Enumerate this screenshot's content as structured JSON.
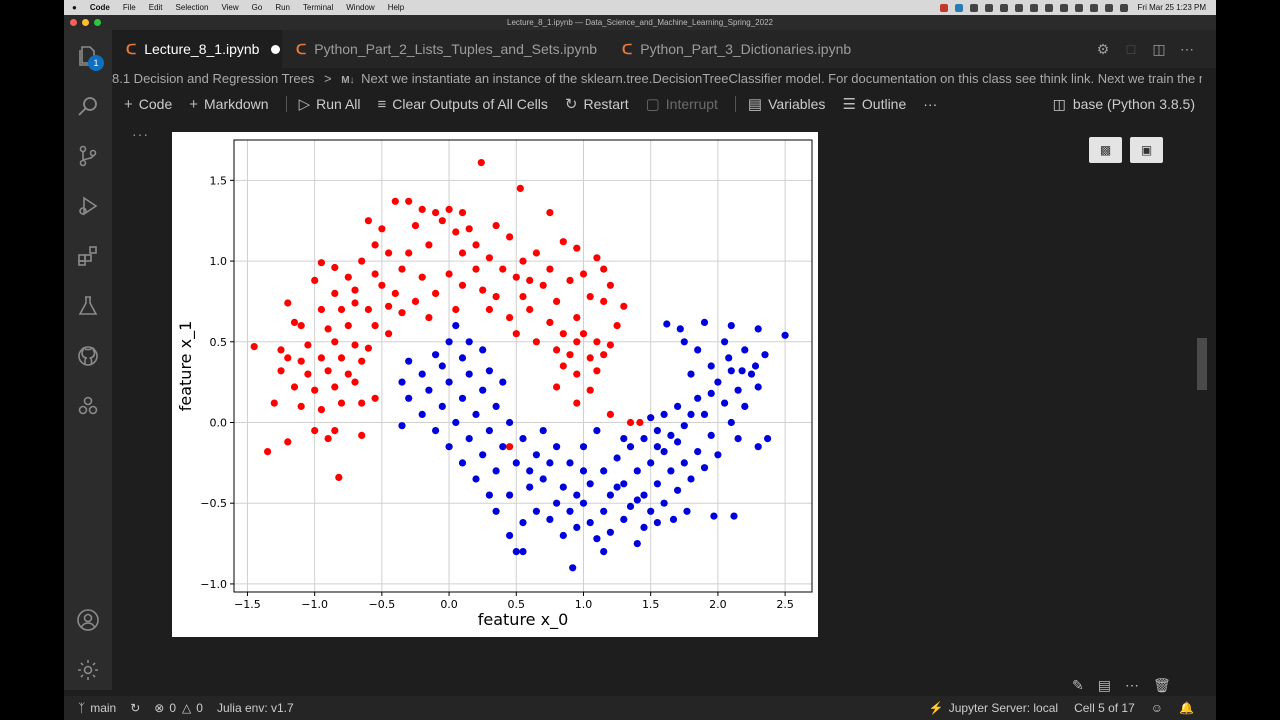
{
  "os_menubar": {
    "apple": "",
    "app_name": "Code",
    "menus": [
      "File",
      "Edit",
      "Selection",
      "View",
      "Go",
      "Run",
      "Terminal",
      "Window",
      "Help"
    ],
    "clock": "Fri Mar 25  1:23 PM"
  },
  "window": {
    "title": "Lecture_8_1.ipynb — Data_Science_and_Machine_Learning_Spring_2022"
  },
  "activity_bar": {
    "explorer_badge": "1",
    "items": [
      "explorer-icon",
      "search-icon",
      "source-control-icon",
      "run-debug-icon",
      "extensions-icon",
      "testing-icon",
      "github-icon",
      "remote-icon"
    ],
    "bottom": [
      "account-icon",
      "settings-gear-icon"
    ]
  },
  "tabs": [
    {
      "label": "Lecture_8_1.ipynb",
      "active": true,
      "dirty": true
    },
    {
      "label": "Python_Part_2_Lists_Tuples_and_Sets.ipynb",
      "active": false
    },
    {
      "label": "Python_Part_3_Dictionaries.ipynb",
      "active": false
    }
  ],
  "breadcrumb": {
    "section": "8.1 Decision and Regression Trees",
    "separator": ">",
    "md_badge": "M↓",
    "cell": "Next we instantiate an instance of the sklearn.tree.DecisionTreeClassifier model. For documentation on this class see think link. Next we train the m..."
  },
  "toolbar": {
    "code": "Code",
    "markdown": "Markdown",
    "run_all": "Run All",
    "clear_outputs": "Clear Outputs of All Cells",
    "restart": "Restart",
    "interrupt": "Interrupt",
    "variables": "Variables",
    "outline": "Outline",
    "more": "···",
    "kernel": "base (Python 3.8.5)"
  },
  "cell_more": "···",
  "status_bar": {
    "branch": "main",
    "errors": "0",
    "warnings": "0",
    "julia": "Julia env: v1.7",
    "jupyter": "Jupyter Server: local",
    "cell_position": "Cell 5 of 17"
  },
  "colors": {
    "class_0": "#ff0000",
    "class_1": "#0000dd",
    "editor_bg": "#1e1e1e",
    "accent": "#0e70c0"
  },
  "chart_data": {
    "type": "scatter",
    "title": "",
    "xlabel": "feature x_0",
    "ylabel": "feature x_1",
    "xlim": [
      -1.6,
      2.7
    ],
    "ylim": [
      -1.05,
      1.75
    ],
    "xticks": [
      -1.5,
      -1.0,
      -0.5,
      0.0,
      0.5,
      1.0,
      1.5,
      2.0,
      2.5
    ],
    "yticks": [
      -1.0,
      -0.5,
      0.0,
      0.5,
      1.0,
      1.5
    ],
    "xtick_labels": [
      "−1.5",
      "−1.0",
      "−0.5",
      "0.0",
      "0.5",
      "1.0",
      "1.5",
      "2.0",
      "2.5"
    ],
    "ytick_labels": [
      "−1.0",
      "−0.5",
      "0.0",
      "0.5",
      "1.0",
      "1.5"
    ],
    "grid": true,
    "series": [
      {
        "color": "#ff0000",
        "points": [
          [
            0.24,
            1.61
          ],
          [
            0.53,
            1.45
          ],
          [
            -0.4,
            1.37
          ],
          [
            -0.3,
            1.37
          ],
          [
            -0.2,
            1.32
          ],
          [
            -0.1,
            1.3
          ],
          [
            0.0,
            1.32
          ],
          [
            0.1,
            1.3
          ],
          [
            -0.6,
            1.25
          ],
          [
            -0.5,
            1.2
          ],
          [
            -0.25,
            1.22
          ],
          [
            -0.05,
            1.25
          ],
          [
            0.05,
            1.18
          ],
          [
            0.15,
            1.2
          ],
          [
            0.35,
            1.22
          ],
          [
            0.45,
            1.15
          ],
          [
            0.75,
            1.3
          ],
          [
            0.95,
            1.08
          ],
          [
            0.85,
            1.12
          ],
          [
            1.1,
            1.02
          ],
          [
            -0.95,
            0.99
          ],
          [
            -0.85,
            0.96
          ],
          [
            -0.65,
            1.0
          ],
          [
            -0.45,
            1.05
          ],
          [
            -0.15,
            1.1
          ],
          [
            0.1,
            1.05
          ],
          [
            0.2,
            1.1
          ],
          [
            0.3,
            1.02
          ],
          [
            0.55,
            1.0
          ],
          [
            0.65,
            1.05
          ],
          [
            0.75,
            0.95
          ],
          [
            1.0,
            0.92
          ],
          [
            1.15,
            0.95
          ],
          [
            1.2,
            0.85
          ],
          [
            -1.0,
            0.88
          ],
          [
            -0.75,
            0.9
          ],
          [
            -0.55,
            0.92
          ],
          [
            -0.35,
            0.95
          ],
          [
            -0.2,
            0.9
          ],
          [
            0.0,
            0.92
          ],
          [
            0.4,
            0.95
          ],
          [
            0.5,
            0.9
          ],
          [
            0.7,
            0.85
          ],
          [
            0.9,
            0.88
          ],
          [
            1.05,
            0.78
          ],
          [
            -0.85,
            0.8
          ],
          [
            -0.7,
            0.82
          ],
          [
            -0.5,
            0.85
          ],
          [
            -0.4,
            0.8
          ],
          [
            -0.25,
            0.75
          ],
          [
            -0.1,
            0.8
          ],
          [
            0.1,
            0.85
          ],
          [
            0.25,
            0.82
          ],
          [
            0.35,
            0.78
          ],
          [
            0.55,
            0.78
          ],
          [
            0.8,
            0.75
          ],
          [
            1.15,
            0.75
          ],
          [
            1.3,
            0.72
          ],
          [
            -1.2,
            0.74
          ],
          [
            -0.95,
            0.7
          ],
          [
            -0.8,
            0.7
          ],
          [
            -0.6,
            0.7
          ],
          [
            -0.45,
            0.72
          ],
          [
            -0.35,
            0.68
          ],
          [
            -0.15,
            0.65
          ],
          [
            0.05,
            0.7
          ],
          [
            0.3,
            0.7
          ],
          [
            0.45,
            0.65
          ],
          [
            0.6,
            0.7
          ],
          [
            0.75,
            0.62
          ],
          [
            0.95,
            0.65
          ],
          [
            1.0,
            0.55
          ],
          [
            1.25,
            0.6
          ],
          [
            -1.15,
            0.62
          ],
          [
            -1.1,
            0.6
          ],
          [
            -0.9,
            0.58
          ],
          [
            -0.75,
            0.6
          ],
          [
            -0.55,
            0.6
          ],
          [
            -0.45,
            0.55
          ],
          [
            0.5,
            0.55
          ],
          [
            0.65,
            0.5
          ],
          [
            0.85,
            0.55
          ],
          [
            0.95,
            0.5
          ],
          [
            1.1,
            0.5
          ],
          [
            1.2,
            0.48
          ],
          [
            -1.45,
            0.47
          ],
          [
            -1.25,
            0.45
          ],
          [
            -1.05,
            0.48
          ],
          [
            -0.85,
            0.5
          ],
          [
            -0.7,
            0.48
          ],
          [
            -0.6,
            0.46
          ],
          [
            0.8,
            0.45
          ],
          [
            0.9,
            0.42
          ],
          [
            1.05,
            0.4
          ],
          [
            1.15,
            0.42
          ],
          [
            -1.2,
            0.4
          ],
          [
            -1.1,
            0.38
          ],
          [
            -0.95,
            0.4
          ],
          [
            -0.8,
            0.4
          ],
          [
            -0.65,
            0.38
          ],
          [
            -1.25,
            0.32
          ],
          [
            -1.05,
            0.3
          ],
          [
            -0.9,
            0.32
          ],
          [
            -0.75,
            0.3
          ],
          [
            0.85,
            0.35
          ],
          [
            0.95,
            0.3
          ],
          [
            1.1,
            0.32
          ],
          [
            -1.15,
            0.22
          ],
          [
            -1.0,
            0.2
          ],
          [
            -0.85,
            0.22
          ],
          [
            -0.7,
            0.25
          ],
          [
            0.8,
            0.22
          ],
          [
            1.05,
            0.2
          ],
          [
            -1.3,
            0.12
          ],
          [
            -1.1,
            0.1
          ],
          [
            -0.95,
            0.08
          ],
          [
            -0.8,
            0.12
          ],
          [
            -0.65,
            0.12
          ],
          [
            -0.55,
            0.15
          ],
          [
            0.95,
            0.12
          ],
          [
            1.2,
            0.05
          ],
          [
            1.35,
            0.0
          ],
          [
            -1.0,
            -0.05
          ],
          [
            -0.9,
            -0.1
          ],
          [
            -1.2,
            -0.12
          ],
          [
            -0.85,
            -0.05
          ],
          [
            -0.65,
            -0.08
          ],
          [
            0.45,
            -0.15
          ],
          [
            -1.35,
            -0.18
          ],
          [
            -0.82,
            -0.34
          ],
          [
            1.42,
            0.0
          ],
          [
            -0.55,
            1.1
          ],
          [
            -0.3,
            1.05
          ],
          [
            0.2,
            0.95
          ],
          [
            0.6,
            0.88
          ],
          [
            -0.7,
            0.74
          ]
        ]
      },
      {
        "color": "#0000dd",
        "points": [
          [
            1.62,
            0.61
          ],
          [
            1.72,
            0.58
          ],
          [
            1.9,
            0.62
          ],
          [
            2.1,
            0.6
          ],
          [
            2.3,
            0.58
          ],
          [
            2.5,
            0.54
          ],
          [
            1.75,
            0.5
          ],
          [
            1.85,
            0.45
          ],
          [
            2.05,
            0.5
          ],
          [
            2.2,
            0.45
          ],
          [
            2.35,
            0.42
          ],
          [
            1.95,
            0.35
          ],
          [
            2.1,
            0.32
          ],
          [
            2.25,
            0.3
          ],
          [
            1.8,
            0.3
          ],
          [
            2.0,
            0.25
          ],
          [
            2.15,
            0.2
          ],
          [
            2.3,
            0.22
          ],
          [
            1.85,
            0.15
          ],
          [
            2.05,
            0.12
          ],
          [
            2.2,
            0.1
          ],
          [
            1.7,
            0.1
          ],
          [
            1.9,
            0.05
          ],
          [
            2.1,
            0.0
          ],
          [
            1.6,
            0.05
          ],
          [
            1.75,
            -0.02
          ],
          [
            1.95,
            -0.08
          ],
          [
            2.15,
            -0.1
          ],
          [
            2.3,
            -0.15
          ],
          [
            1.55,
            -0.05
          ],
          [
            1.7,
            -0.12
          ],
          [
            1.85,
            -0.18
          ],
          [
            2.0,
            -0.2
          ],
          [
            1.45,
            -0.1
          ],
          [
            1.6,
            -0.18
          ],
          [
            1.75,
            -0.25
          ],
          [
            1.9,
            -0.28
          ],
          [
            1.35,
            -0.15
          ],
          [
            1.5,
            -0.25
          ],
          [
            1.65,
            -0.3
          ],
          [
            1.8,
            -0.35
          ],
          [
            1.25,
            -0.22
          ],
          [
            1.4,
            -0.3
          ],
          [
            1.55,
            -0.38
          ],
          [
            1.7,
            -0.42
          ],
          [
            1.15,
            -0.3
          ],
          [
            1.3,
            -0.38
          ],
          [
            1.45,
            -0.45
          ],
          [
            1.6,
            -0.5
          ],
          [
            1.05,
            -0.38
          ],
          [
            1.2,
            -0.45
          ],
          [
            1.35,
            -0.52
          ],
          [
            1.5,
            -0.55
          ],
          [
            1.0,
            -0.5
          ],
          [
            1.15,
            -0.55
          ],
          [
            1.3,
            -0.6
          ],
          [
            1.45,
            -0.65
          ],
          [
            0.9,
            -0.55
          ],
          [
            1.05,
            -0.62
          ],
          [
            1.2,
            -0.68
          ],
          [
            0.8,
            -0.5
          ],
          [
            0.95,
            -0.65
          ],
          [
            1.1,
            -0.72
          ],
          [
            0.75,
            -0.6
          ],
          [
            0.85,
            -0.7
          ],
          [
            0.65,
            -0.55
          ],
          [
            0.55,
            -0.62
          ],
          [
            0.45,
            -0.7
          ],
          [
            0.35,
            -0.55
          ],
          [
            0.5,
            -0.8
          ],
          [
            0.55,
            -0.8
          ],
          [
            0.92,
            -0.9
          ],
          [
            0.3,
            -0.45
          ],
          [
            0.45,
            -0.45
          ],
          [
            0.6,
            -0.4
          ],
          [
            0.7,
            -0.35
          ],
          [
            0.85,
            -0.4
          ],
          [
            1.0,
            -0.3
          ],
          [
            0.2,
            -0.35
          ],
          [
            0.35,
            -0.3
          ],
          [
            0.5,
            -0.25
          ],
          [
            0.65,
            -0.2
          ],
          [
            0.8,
            -0.15
          ],
          [
            0.9,
            -0.25
          ],
          [
            0.1,
            -0.25
          ],
          [
            0.25,
            -0.2
          ],
          [
            0.4,
            -0.15
          ],
          [
            0.55,
            -0.1
          ],
          [
            0.7,
            -0.05
          ],
          [
            0.0,
            -0.15
          ],
          [
            0.15,
            -0.1
          ],
          [
            0.3,
            -0.05
          ],
          [
            0.45,
            0.0
          ],
          [
            -0.1,
            -0.05
          ],
          [
            0.05,
            0.0
          ],
          [
            0.2,
            0.05
          ],
          [
            0.35,
            0.1
          ],
          [
            -0.2,
            0.05
          ],
          [
            -0.05,
            0.1
          ],
          [
            0.1,
            0.15
          ],
          [
            0.25,
            0.2
          ],
          [
            -0.3,
            0.15
          ],
          [
            -0.15,
            0.2
          ],
          [
            0.0,
            0.25
          ],
          [
            0.15,
            0.3
          ],
          [
            -0.35,
            0.25
          ],
          [
            -0.2,
            0.3
          ],
          [
            -0.05,
            0.35
          ],
          [
            0.1,
            0.4
          ],
          [
            -0.3,
            0.38
          ],
          [
            -0.1,
            0.42
          ],
          [
            0.0,
            0.5
          ],
          [
            0.15,
            0.5
          ],
          [
            -0.35,
            -0.02
          ],
          [
            0.05,
            0.6
          ],
          [
            0.25,
            0.45
          ],
          [
            0.3,
            0.32
          ],
          [
            0.4,
            0.25
          ],
          [
            1.5,
            0.03
          ],
          [
            1.3,
            -0.1
          ],
          [
            1.0,
            -0.15
          ],
          [
            1.1,
            -0.05
          ],
          [
            0.75,
            -0.25
          ],
          [
            0.6,
            -0.3
          ],
          [
            0.95,
            -0.45
          ],
          [
            1.25,
            -0.4
          ],
          [
            1.4,
            -0.48
          ],
          [
            1.55,
            -0.15
          ],
          [
            1.65,
            -0.08
          ],
          [
            1.8,
            0.05
          ],
          [
            1.95,
            0.18
          ],
          [
            2.08,
            0.4
          ],
          [
            2.18,
            0.32
          ],
          [
            2.28,
            0.35
          ],
          [
            2.37,
            -0.1
          ],
          [
            2.12,
            -0.58
          ],
          [
            1.97,
            -0.58
          ],
          [
            1.77,
            -0.55
          ],
          [
            1.67,
            -0.6
          ],
          [
            1.55,
            -0.62
          ],
          [
            1.4,
            -0.75
          ],
          [
            1.15,
            -0.8
          ]
        ]
      }
    ]
  }
}
